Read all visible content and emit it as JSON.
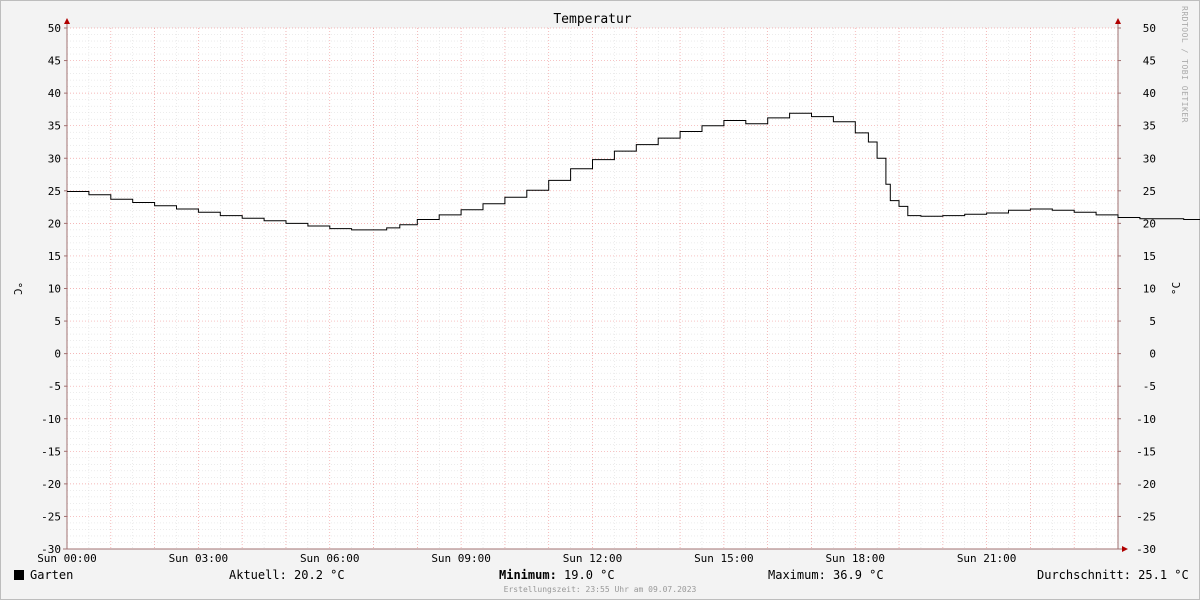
{
  "chart_data": {
    "type": "line",
    "title": "Temperatur",
    "ylabel": "°C",
    "xlabel": "",
    "ylim": [
      -30,
      50
    ],
    "yticks": [
      50,
      45,
      40,
      35,
      30,
      25,
      20,
      15,
      10,
      5,
      0,
      -5,
      -10,
      -15,
      -20,
      -25,
      -30
    ],
    "xlim_hours": [
      0,
      24
    ],
    "xticks": [
      {
        "hour": 0,
        "label": "Sun 00:00"
      },
      {
        "hour": 3,
        "label": "Sun 03:00"
      },
      {
        "hour": 6,
        "label": "Sun 06:00"
      },
      {
        "hour": 9,
        "label": "Sun 09:00"
      },
      {
        "hour": 12,
        "label": "Sun 12:00"
      },
      {
        "hour": 15,
        "label": "Sun 15:00"
      },
      {
        "hour": 18,
        "label": "Sun 18:00"
      },
      {
        "hour": 21,
        "label": "Sun 21:00"
      }
    ],
    "grid": true,
    "series": [
      {
        "name": "Garten",
        "color": "#000000",
        "points": [
          [
            0,
            24.9
          ],
          [
            0.5,
            24.4
          ],
          [
            1,
            23.7
          ],
          [
            1.5,
            23.2
          ],
          [
            2,
            22.7
          ],
          [
            2.5,
            22.2
          ],
          [
            3,
            21.7
          ],
          [
            3.5,
            21.2
          ],
          [
            4,
            20.8
          ],
          [
            4.5,
            20.4
          ],
          [
            5,
            20.0
          ],
          [
            5.5,
            19.6
          ],
          [
            6,
            19.2
          ],
          [
            6.5,
            19.0
          ],
          [
            7,
            19.0
          ],
          [
            7.3,
            19.3
          ],
          [
            7.6,
            19.8
          ],
          [
            8,
            20.6
          ],
          [
            8.5,
            21.3
          ],
          [
            9,
            22.1
          ],
          [
            9.5,
            23.0
          ],
          [
            10,
            24.0
          ],
          [
            10.5,
            25.1
          ],
          [
            11,
            26.6
          ],
          [
            11.5,
            28.4
          ],
          [
            12,
            29.8
          ],
          [
            12.5,
            31.1
          ],
          [
            13,
            32.1
          ],
          [
            13.5,
            33.1
          ],
          [
            14,
            34.1
          ],
          [
            14.5,
            35.0
          ],
          [
            15,
            35.8
          ],
          [
            15.5,
            35.3
          ],
          [
            16,
            36.2
          ],
          [
            16.5,
            36.9
          ],
          [
            17,
            36.4
          ],
          [
            17.5,
            35.6
          ],
          [
            18,
            33.9
          ],
          [
            18.3,
            32.5
          ],
          [
            18.5,
            30.0
          ],
          [
            18.7,
            26.0
          ],
          [
            18.8,
            23.5
          ],
          [
            19.0,
            22.6
          ],
          [
            19.2,
            21.2
          ],
          [
            19.5,
            21.1
          ],
          [
            20,
            21.2
          ],
          [
            20.5,
            21.4
          ],
          [
            21,
            21.6
          ],
          [
            21.5,
            22.0
          ],
          [
            22,
            22.2
          ],
          [
            22.5,
            22.0
          ],
          [
            23,
            21.7
          ],
          [
            23.5,
            21.3
          ],
          [
            24,
            20.9
          ],
          [
            24.5,
            20.7
          ],
          [
            25,
            20.7
          ],
          [
            25.5,
            20.6
          ],
          [
            26,
            20.5
          ],
          [
            26.5,
            20.3
          ],
          [
            27,
            20.2
          ]
        ]
      }
    ],
    "legend": {
      "series_name": "Garten",
      "current_label": "Aktuell:",
      "current_value": "20.2 °C",
      "min_label": "Minimum:",
      "min_value": "19.0 °C",
      "max_label": "Maximum:",
      "max_value": "36.9 °C",
      "avg_label": "Durchschnitt:",
      "avg_value": "25.1 °C"
    },
    "footer": "Erstellungszeit: 23:55 Uhr am 09.07.2023",
    "credit": "RRDTOOL / TOBI OETIKER",
    "colors": {
      "background": "#f3f3f3",
      "canvas": "#ffffff",
      "major_grid": "#f2a0a0",
      "minor_grid": "#d8d8d8",
      "axis": "#a07070",
      "arrow": "#b00000"
    }
  }
}
